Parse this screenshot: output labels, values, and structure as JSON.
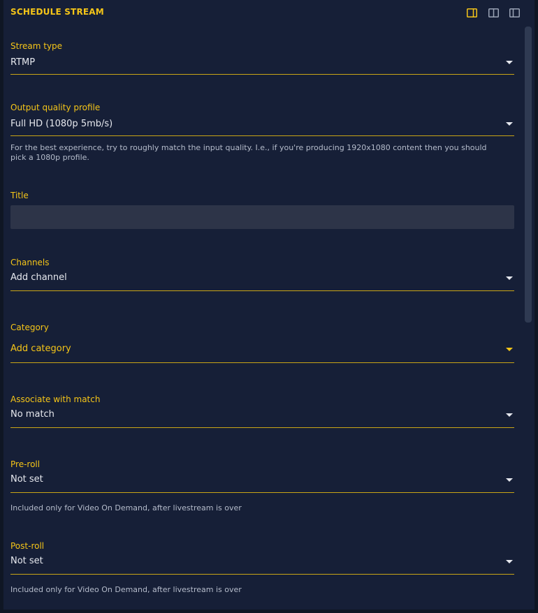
{
  "panel": {
    "title": "SCHEDULE STREAM",
    "layout_buttons": [
      {
        "icon": "sidebar-right-icon",
        "active": true
      },
      {
        "icon": "split-columns-icon",
        "active": false
      },
      {
        "icon": "sidebar-left-icon",
        "active": false
      }
    ]
  },
  "colors": {
    "accent": "#f5c518",
    "background": "#161f37",
    "input_background": "#2d3448",
    "text": "#e6e8ee",
    "helper_text": "#b5bccb"
  },
  "form": {
    "stream_type": {
      "label": "Stream type",
      "value": "RTMP"
    },
    "output_quality": {
      "label": "Output quality profile",
      "value": "Full HD (1080p 5mb/s)",
      "helper": "For the best experience, try to roughly match the input quality. I.e., if you're producing 1920x1080 content then you should pick a 1080p profile."
    },
    "title": {
      "label": "Title",
      "value": "",
      "placeholder": ""
    },
    "channels": {
      "label": "Channels",
      "value": "Add channel"
    },
    "category": {
      "label": "Category",
      "value": "Add category"
    },
    "match": {
      "label": "Associate with match",
      "value": "No match"
    },
    "preroll": {
      "label": "Pre-roll",
      "value": "Not set",
      "helper": "Included only for Video On Demand, after livestream is over"
    },
    "postroll": {
      "label": "Post-roll",
      "value": "Not set",
      "helper": "Included only for Video On Demand, after livestream is over"
    }
  }
}
